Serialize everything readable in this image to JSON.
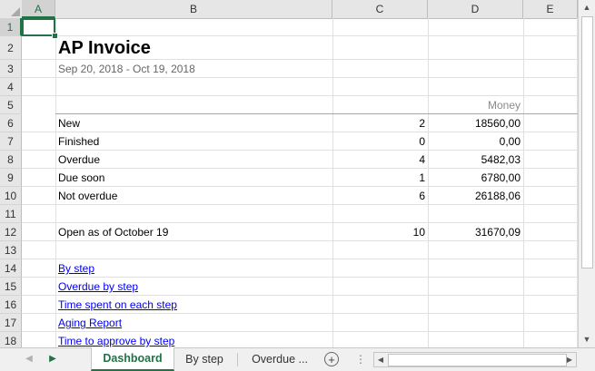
{
  "columns": [
    "A",
    "B",
    "C",
    "D",
    "E"
  ],
  "rows": [
    "1",
    "2",
    "3",
    "4",
    "5",
    "6",
    "7",
    "8",
    "9",
    "10",
    "11",
    "12",
    "13",
    "14",
    "15",
    "16",
    "17",
    "18"
  ],
  "report": {
    "title": "AP Invoice",
    "date_range": "Sep 20, 2018 - Oct 19, 2018",
    "money_header": "Money"
  },
  "stats": [
    {
      "label": "New",
      "count": "2",
      "money": "18560,00"
    },
    {
      "label": "Finished",
      "count": "0",
      "money": "0,00"
    },
    {
      "label": "Overdue",
      "count": "4",
      "money": "5482,03"
    },
    {
      "label": "Due soon",
      "count": "1",
      "money": "6780,00"
    },
    {
      "label": "Not overdue",
      "count": "6",
      "money": "26188,06"
    }
  ],
  "open": {
    "label": "Open as of October 19",
    "count": "10",
    "money": "31670,09"
  },
  "links": [
    "By step",
    "Overdue by step",
    "Time spent on each step",
    "Aging Report",
    "Time to approve by step"
  ],
  "tabs": {
    "dashboard": "Dashboard",
    "by_step": "By step",
    "overdue": "Overdue ...",
    "add": "+"
  },
  "colors": {
    "accent": "#217346",
    "link": "#0000ee"
  }
}
